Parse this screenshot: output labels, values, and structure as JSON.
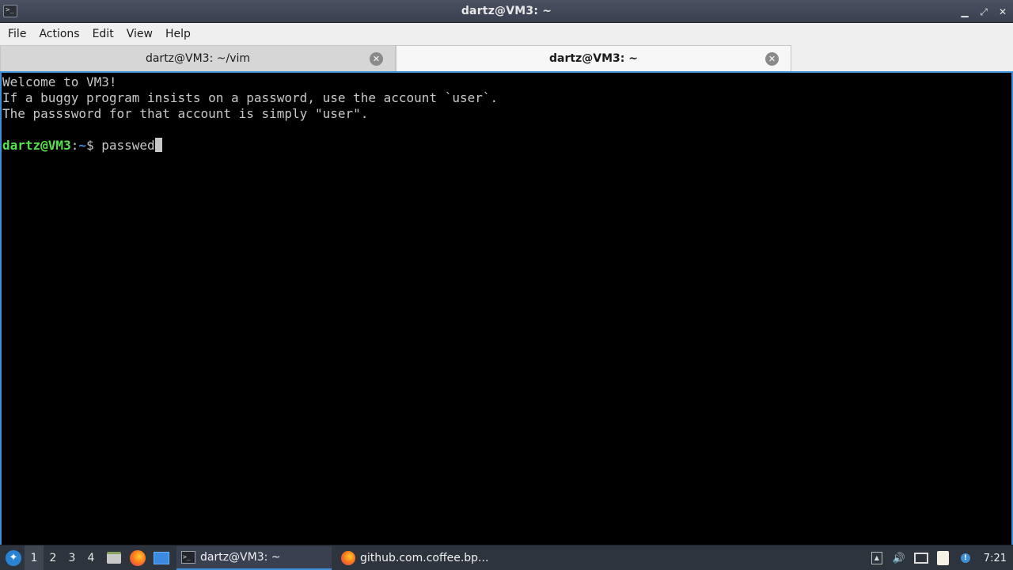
{
  "window": {
    "title": "dartz@VM3: ~",
    "app_icon": "terminal-icon",
    "controls": {
      "minimize": "▁",
      "maximize": "⤢",
      "close": "✕"
    }
  },
  "menu": [
    {
      "label": "File"
    },
    {
      "label": "Actions"
    },
    {
      "label": "Edit"
    },
    {
      "label": "View"
    },
    {
      "label": "Help"
    }
  ],
  "tabs": [
    {
      "label": "dartz@VM3: ~/vim",
      "active": false,
      "close": "✕"
    },
    {
      "label": "dartz@VM3: ~",
      "active": true,
      "close": "✕"
    }
  ],
  "terminal": {
    "lines": [
      "Welcome to VM3!",
      "If a buggy program insists on a password, use the account `user`.",
      "The passsword for that account is simply \"user\".",
      ""
    ],
    "prompt_user": "dartz@VM3",
    "prompt_sep": ":",
    "prompt_path": "~",
    "prompt_symbol": "$ ",
    "command": "passwed"
  },
  "taskbar": {
    "start_icon": "lxqt-menu-icon",
    "workspaces": [
      "1",
      "2",
      "3",
      "4"
    ],
    "current_workspace": "1",
    "quicklaunch": [
      "file-manager-icon",
      "firefox-icon",
      "show-desktop-icon"
    ],
    "tasks": [
      {
        "label": "dartz@VM3: ~",
        "icon": "terminal-icon",
        "active": true
      },
      {
        "label": "github.com.coffee.bp...",
        "icon": "firefox-icon",
        "active": false
      }
    ],
    "tray": [
      "tray-expand-icon",
      "volume-icon",
      "network-icon",
      "clipboard-icon",
      "notification-icon"
    ],
    "clock": "7:21"
  },
  "colors": {
    "prompt_user": "#54e34a",
    "prompt_path": "#4a8ad8",
    "terminal_bg": "#000000",
    "accent": "#3e8fd8"
  }
}
